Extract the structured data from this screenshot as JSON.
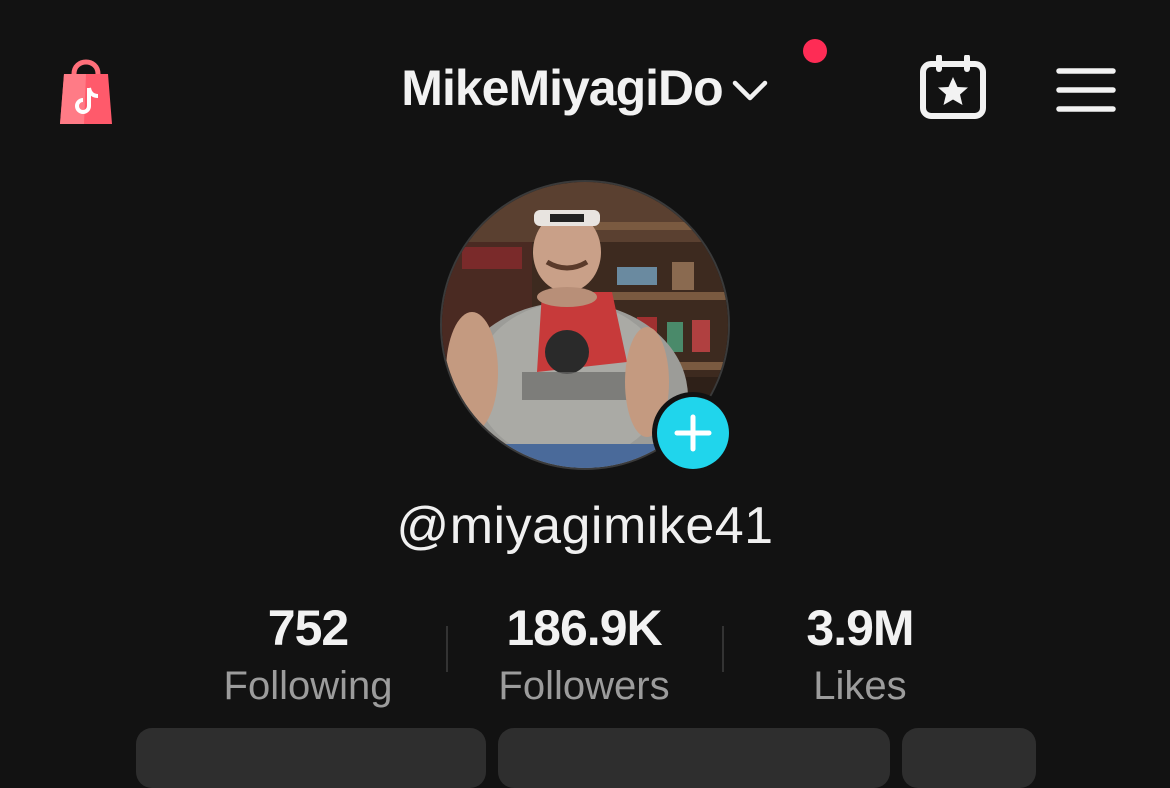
{
  "header": {
    "account_name": "MikeMiyagiDo",
    "shop_icon": "shopping-bag-icon",
    "switcher_icon": "chevron-down-icon",
    "calendar_icon": "calendar-star-icon",
    "menu_icon": "hamburger-menu-icon",
    "notification_dot_color": "#fe2c55"
  },
  "profile": {
    "username": "@miyagimike41",
    "add_icon": "plus-icon",
    "accent_color": "#20d5ec"
  },
  "stats": [
    {
      "value": "752",
      "label": "Following"
    },
    {
      "value": "186.9K",
      "label": "Followers"
    },
    {
      "value": "3.9M",
      "label": "Likes"
    }
  ]
}
